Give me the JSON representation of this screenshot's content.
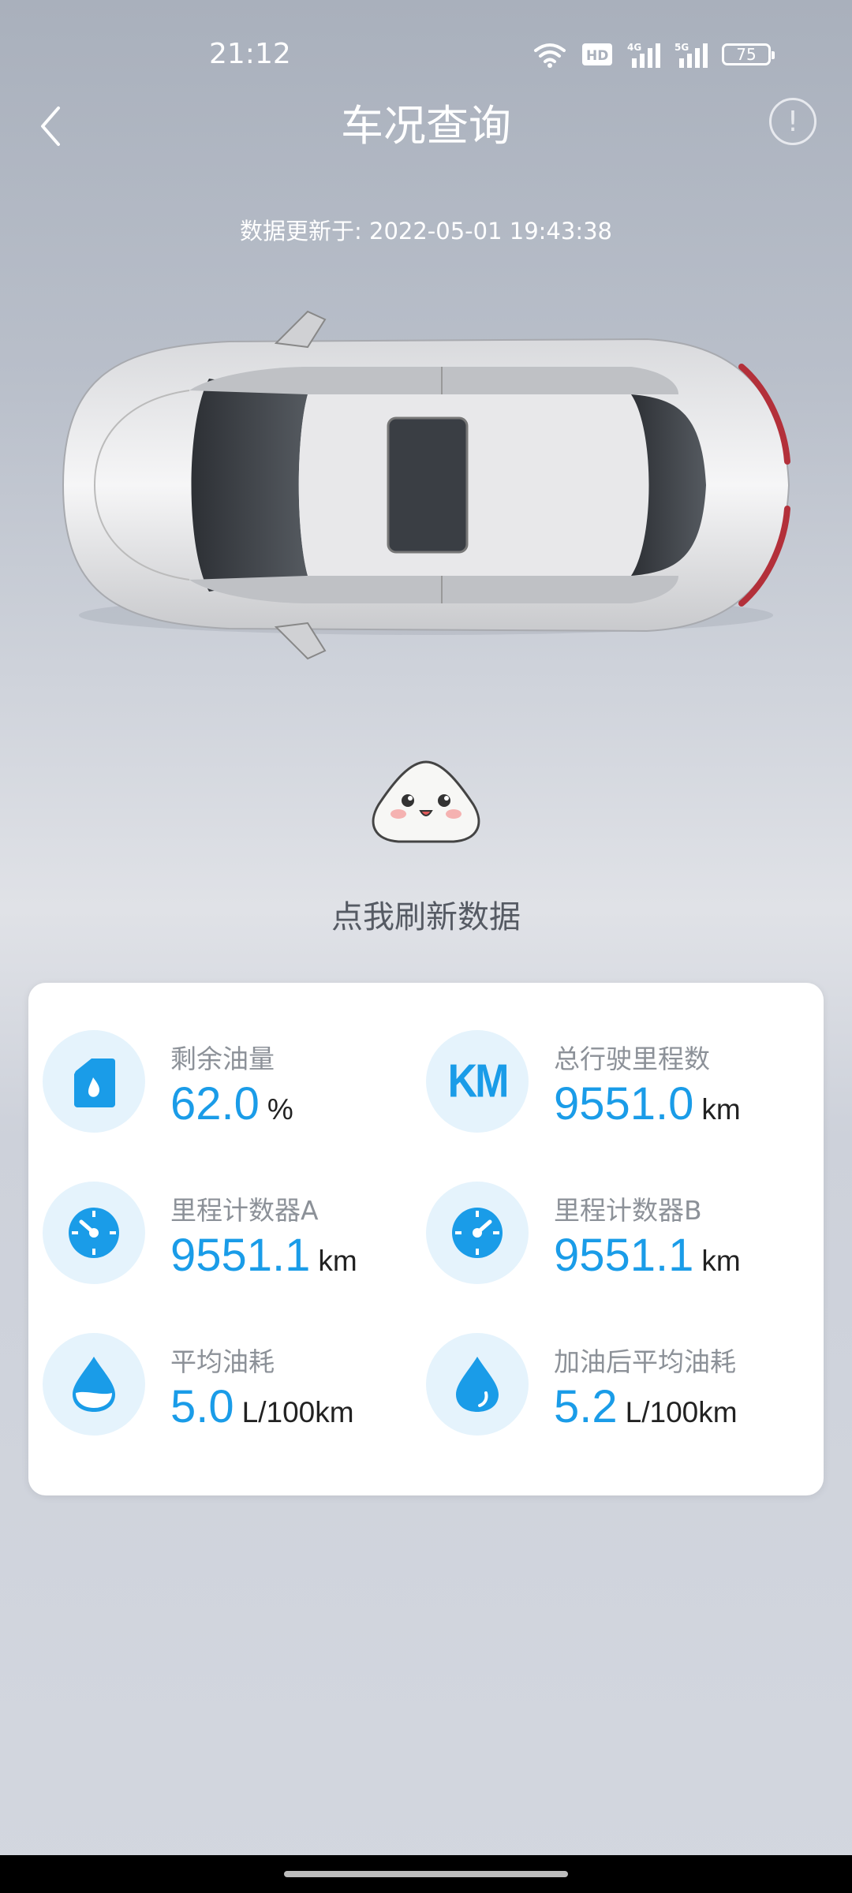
{
  "status_bar": {
    "time": "21:12",
    "network_1": "4G",
    "network_2": "5G",
    "hd_label": "HD",
    "battery": "75"
  },
  "header": {
    "title": "车况查询"
  },
  "update": {
    "text": "数据更新于: 2022-05-01 19:43:38"
  },
  "refresh": {
    "label": "点我刷新数据"
  },
  "stats": [
    {
      "label": "剩余油量",
      "value": "62.0",
      "unit": "%",
      "icon": "fuel-can-icon"
    },
    {
      "label": "总行驶里程数",
      "value": "9551.0",
      "unit": "km",
      "icon": "km-icon",
      "icon_text": "KM"
    },
    {
      "label": "里程计数器A",
      "value": "9551.1",
      "unit": "km",
      "icon": "gauge-icon"
    },
    {
      "label": "里程计数器B",
      "value": "9551.1",
      "unit": "km",
      "icon": "gauge-icon"
    },
    {
      "label": "平均油耗",
      "value": "5.0",
      "unit": "L/100km",
      "icon": "half-drop-icon"
    },
    {
      "label": "加油后平均油耗",
      "value": "5.2",
      "unit": "L/100km",
      "icon": "drop-icon"
    }
  ],
  "colors": {
    "accent": "#1a9ce8",
    "icon_bg": "#e5f3fc"
  }
}
